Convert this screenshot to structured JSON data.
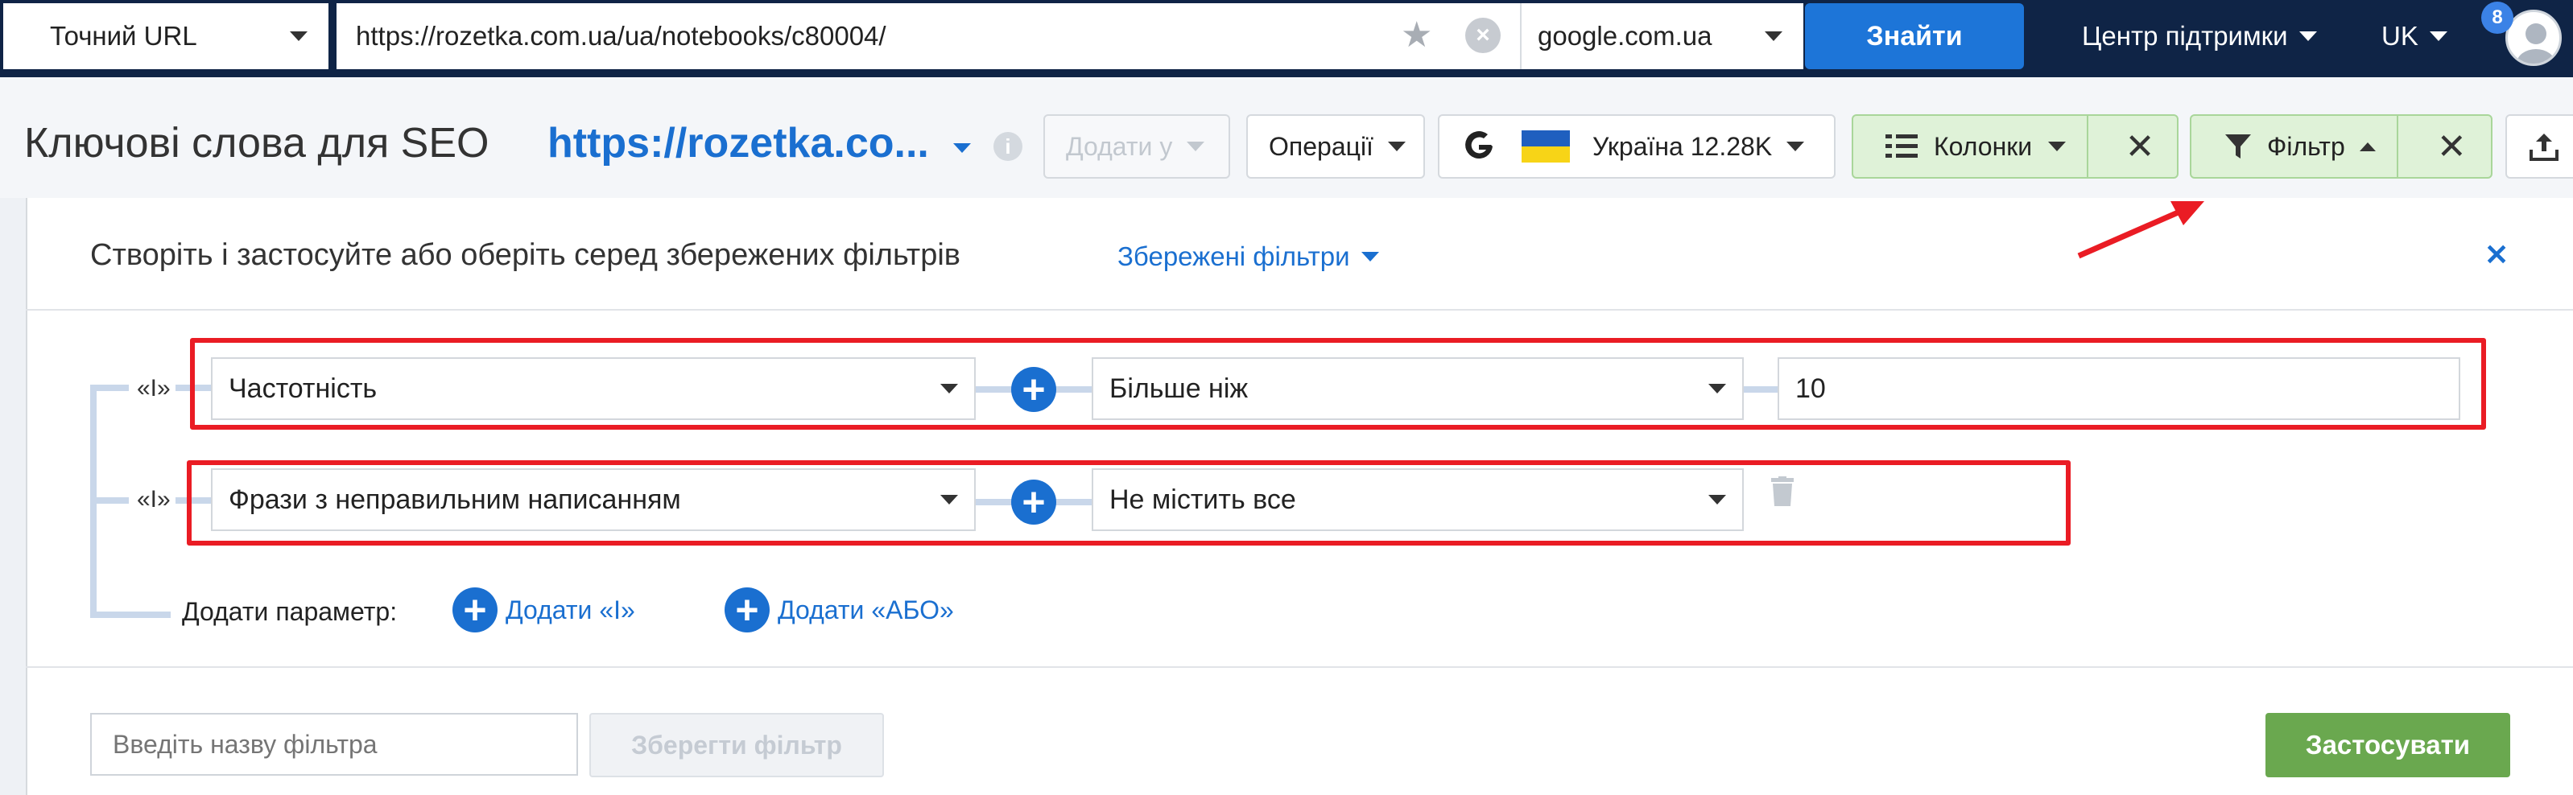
{
  "topbar": {
    "mode_select": "Точний URL",
    "url_value": "https://rozetka.com.ua/ua/notebooks/c80004/",
    "engine_select": "google.com.ua",
    "search_button": "Знайти",
    "support_menu": "Центр підтримки",
    "lang_menu": "UK",
    "notification_count": "8"
  },
  "toolbar": {
    "title": "Ключові слова для SEO",
    "url_short": "https://rozetka.co...",
    "add_to_button": "Додати у",
    "operations_button": "Операції",
    "region_label": "Україна 12.28K",
    "columns_button": "Колонки",
    "filter_button": "Фільтр"
  },
  "panel": {
    "header_text": "Створіть і застосуйте або оберіть серед збережених фільтрів",
    "saved_filters_link": "Збережені фільтри",
    "rows": [
      {
        "conj": "«І»",
        "param": "Частотність",
        "operator": "Більше ніж",
        "value": "10"
      },
      {
        "conj": "«І»",
        "param": "Фрази з неправильним написанням",
        "operator": "Не містить все",
        "value": ""
      }
    ],
    "add_param_label": "Додати параметр:",
    "add_and": "Додати «І»",
    "add_or": "Додати «АБО»",
    "filter_name_placeholder": "Введіть назву фільтра",
    "save_filter_button": "Зберегти фільтр",
    "apply_button": "Застосувати"
  },
  "colors": {
    "topbar_bg": "#0f2446",
    "accent_blue": "#1a6fd0",
    "apply_green": "#6aa84f",
    "annotation_red": "#ea1c24"
  }
}
